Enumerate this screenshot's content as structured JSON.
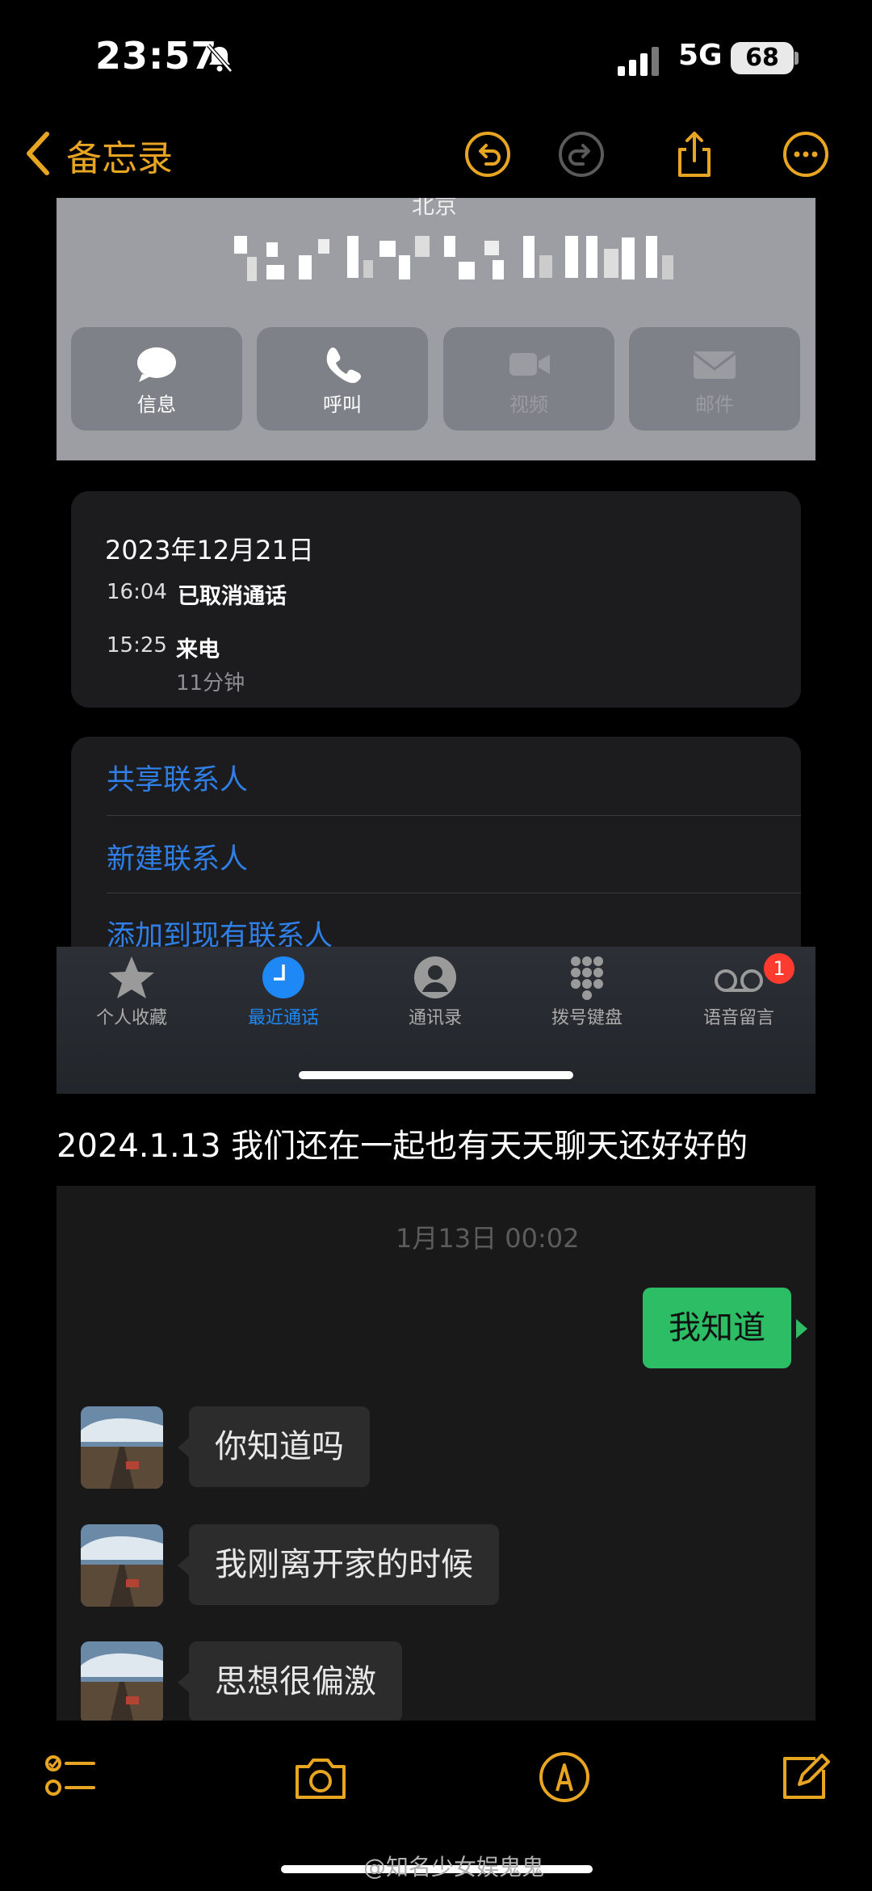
{
  "status_bar": {
    "time": "23:57",
    "network": "5G",
    "battery": "68"
  },
  "nav": {
    "back_label": "备忘录"
  },
  "contact": {
    "city": "北京",
    "actions": [
      {
        "label": "信息",
        "icon": "message-icon",
        "enabled": true
      },
      {
        "label": "呼叫",
        "icon": "phone-icon",
        "enabled": true
      },
      {
        "label": "视频",
        "icon": "video-icon",
        "enabled": false
      },
      {
        "label": "邮件",
        "icon": "mail-icon",
        "enabled": false
      }
    ]
  },
  "recents": {
    "date": "2023年12月21日",
    "entries": [
      {
        "time": "16:04",
        "type": "已取消通话"
      },
      {
        "time": "15:25",
        "type": "来电",
        "duration": "11分钟"
      }
    ]
  },
  "links": [
    "共享联系人",
    "新建联系人",
    "添加到现有联系人"
  ],
  "tabbar": {
    "tabs": [
      {
        "label": "个人收藏",
        "icon": "star-icon"
      },
      {
        "label": "最近通话",
        "icon": "clock-icon",
        "active": true
      },
      {
        "label": "通讯录",
        "icon": "contacts-icon"
      },
      {
        "label": "拨号键盘",
        "icon": "keypad-icon"
      },
      {
        "label": "语音留言",
        "icon": "voicemail-icon",
        "badge": "1"
      }
    ],
    "accent": "#1e88f7"
  },
  "note": {
    "text": "2024.1.13 我们还在一起也有天天聊天还好好的"
  },
  "chat": {
    "timestamp": "1月13日 00:02",
    "messages": [
      {
        "from": "me",
        "text": "我知道"
      },
      {
        "from": "other",
        "text": "你知道吗"
      },
      {
        "from": "other",
        "text": "我刚离开家的时候"
      },
      {
        "from": "other",
        "text": "思想很偏激"
      }
    ]
  },
  "watermark": "@知名少女娱鬼鬼",
  "colors": {
    "notes_accent": "#e8a521",
    "link_blue": "#2f7fe6",
    "wechat_green": "#2dbd65",
    "badge_red": "#ff3b30"
  }
}
